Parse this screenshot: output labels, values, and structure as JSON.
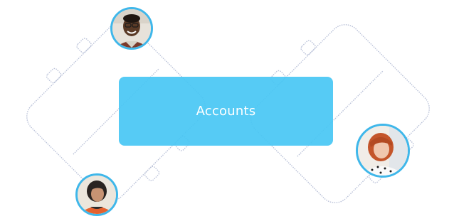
{
  "colors": {
    "accent": "#48c7f4",
    "outline": "#b9c1d8",
    "avatar_ring": "#3fb7ea",
    "background": "#ffffff"
  },
  "main": {
    "accounts_button_label": "Accounts"
  },
  "avatars": [
    {
      "name": "avatar-man-glasses"
    },
    {
      "name": "avatar-woman-dark-hair"
    },
    {
      "name": "avatar-woman-red-hair"
    }
  ]
}
